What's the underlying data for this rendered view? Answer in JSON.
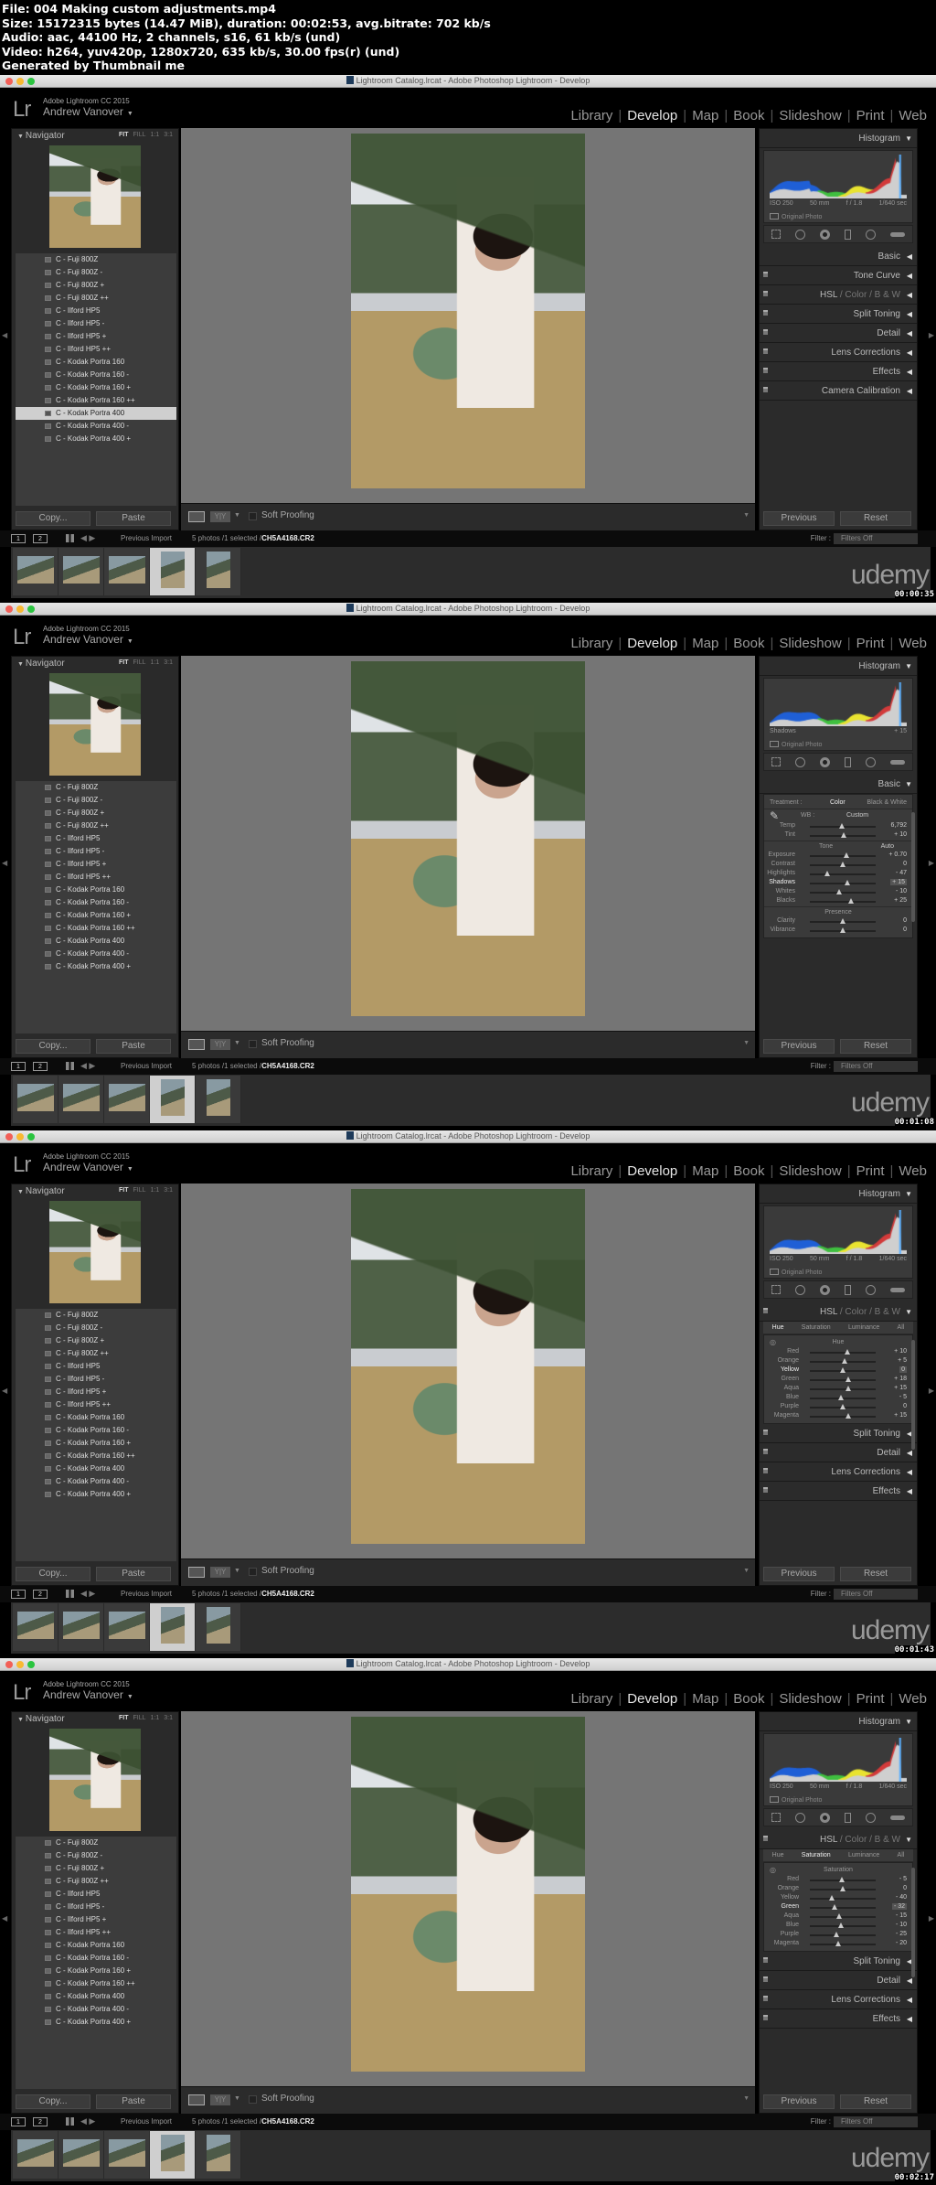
{
  "file_info": {
    "lines": [
      "File: 004 Making custom adjustments.mp4",
      "Size: 15172315 bytes (14.47 MiB), duration: 00:02:53, avg.bitrate: 702 kb/s",
      "Audio: aac, 44100 Hz, 2 channels, s16, 61 kb/s (und)",
      "Video: h264, yuv420p, 1280x720, 635 kb/s, 30.00 fps(r) (und)",
      "Generated by Thumbnail me"
    ]
  },
  "app": {
    "window_title": "Lightroom Catalog.lrcat - Adobe Photoshop Lightroom - Develop",
    "logo": "Lr",
    "product": "Adobe Lightroom CC 2015",
    "user": "Andrew Vanover",
    "user_caret": "▼",
    "modules": [
      "Library",
      "Develop",
      "Map",
      "Book",
      "Slideshow",
      "Print",
      "Web"
    ],
    "active_module": "Develop",
    "navigator": {
      "label": "Navigator",
      "zoom_options": [
        "FIT",
        "FILL",
        "1:1",
        "3:1"
      ],
      "active_zoom": "FIT"
    },
    "presets": [
      "C - Fuji 800Z",
      "C - Fuji 800Z -",
      "C - Fuji 800Z +",
      "C - Fuji 800Z ++",
      "C - Ilford HP5",
      "C - Ilford HP5 -",
      "C - Ilford HP5 +",
      "C - Ilford HP5 ++",
      "C - Kodak Portra 160",
      "C - Kodak Portra 160 -",
      "C - Kodak Portra 160 +",
      "C - Kodak Portra 160 ++",
      "C - Kodak Portra 400",
      "C - Kodak Portra 400 -",
      "C - Kodak Portra 400 +"
    ],
    "copy_label": "Copy...",
    "paste_label": "Paste",
    "soft_proofing_label": "Soft Proofing",
    "previous_label": "Previous",
    "reset_label": "Reset",
    "histogram_label": "Histogram",
    "original_photo_label": "Original Photo",
    "exif": {
      "iso": "ISO 250",
      "focal": "50 mm",
      "aperture": "f / 1.8",
      "shutter": "1/640 sec"
    },
    "filmstrip_bar": {
      "view1": "1",
      "view2": "2",
      "source": "Previous Import",
      "count_prefix": "5 photos /1 selected /",
      "filename": "CH5A4168.CR2",
      "filter_label": "Filter :",
      "filter_value": "Filters Off"
    },
    "thumbnail_count": 5,
    "selected_thumbnail": 4,
    "watermark": "udemy"
  },
  "frames": [
    {
      "timecode": "00:00:35",
      "selected_preset": "C - Kodak Portra 400",
      "histogram_caption_left": "ISO 250",
      "right_panels": [
        "Basic",
        "Tone Curve",
        "HSL / Color / B & W",
        "Split Toning",
        "Detail",
        "Lens Corrections",
        "Effects",
        "Camera Calibration"
      ]
    },
    {
      "timecode": "00:01:08",
      "histogram_readout": {
        "label": "Shadows",
        "value": "+ 15"
      },
      "basic": {
        "label": "Basic",
        "treatment_label": "Treatment :",
        "treatment_options": [
          "Color",
          "Black & White"
        ],
        "treatment_active": "Color",
        "wb_label": "WB :",
        "wb_value": "Custom",
        "tone_label": "Tone",
        "auto_label": "Auto",
        "presence_label": "Presence",
        "wb_sliders": [
          {
            "name": "Temp",
            "value": "6,792",
            "position": 0.48
          },
          {
            "name": "Tint",
            "value": "+ 10",
            "position": 0.52
          }
        ],
        "tone_sliders": [
          {
            "name": "Exposure",
            "value": "+ 0.70",
            "position": 0.55
          },
          {
            "name": "Contrast",
            "value": "0",
            "position": 0.5
          },
          {
            "name": "Highlights",
            "value": "- 47",
            "position": 0.27
          },
          {
            "name": "Shadows",
            "value": "+ 15",
            "position": 0.57,
            "active": true
          },
          {
            "name": "Whites",
            "value": "- 10",
            "position": 0.45
          },
          {
            "name": "Blacks",
            "value": "+ 25",
            "position": 0.62
          }
        ],
        "presence_sliders": [
          {
            "name": "Clarity",
            "value": "0",
            "position": 0.5
          },
          {
            "name": "Vibrance",
            "value": "0",
            "position": 0.5
          }
        ]
      }
    },
    {
      "timecode": "00:01:43",
      "hsl": {
        "header": [
          "HSL",
          "Color",
          "B & W"
        ],
        "tabs": [
          "Hue",
          "Saturation",
          "Luminance",
          "All"
        ],
        "active_tab": "Hue",
        "section": "Hue",
        "sliders": [
          {
            "name": "Red",
            "value": "+ 10",
            "position": 0.57
          },
          {
            "name": "Orange",
            "value": "+ 5",
            "position": 0.53
          },
          {
            "name": "Yellow",
            "value": "0",
            "position": 0.5,
            "active": true
          },
          {
            "name": "Green",
            "value": "+ 18",
            "position": 0.59
          },
          {
            "name": "Aqua",
            "value": "+ 15",
            "position": 0.58
          },
          {
            "name": "Blue",
            "value": "- 5",
            "position": 0.47
          },
          {
            "name": "Purple",
            "value": "0",
            "position": 0.5
          },
          {
            "name": "Magenta",
            "value": "+ 15",
            "position": 0.58
          }
        ]
      },
      "collapsed_panels": [
        "Split Toning",
        "Detail",
        "Lens Corrections",
        "Effects"
      ]
    },
    {
      "timecode": "00:02:17",
      "hsl": {
        "header": [
          "HSL",
          "Color",
          "B & W"
        ],
        "tabs": [
          "Hue",
          "Saturation",
          "Luminance",
          "All"
        ],
        "active_tab": "Saturation",
        "section": "Saturation",
        "sliders": [
          {
            "name": "Red",
            "value": "- 5",
            "position": 0.48
          },
          {
            "name": "Orange",
            "value": "0",
            "position": 0.5
          },
          {
            "name": "Yellow",
            "value": "- 40",
            "position": 0.33
          },
          {
            "name": "Green",
            "value": "- 32",
            "position": 0.37,
            "active": true
          },
          {
            "name": "Aqua",
            "value": "- 15",
            "position": 0.45
          },
          {
            "name": "Blue",
            "value": "- 10",
            "position": 0.47
          },
          {
            "name": "Purple",
            "value": "- 25",
            "position": 0.4
          },
          {
            "name": "Magenta",
            "value": "- 20",
            "position": 0.43
          }
        ]
      },
      "collapsed_panels": [
        "Split Toning",
        "Detail",
        "Lens Corrections",
        "Effects"
      ]
    }
  ]
}
